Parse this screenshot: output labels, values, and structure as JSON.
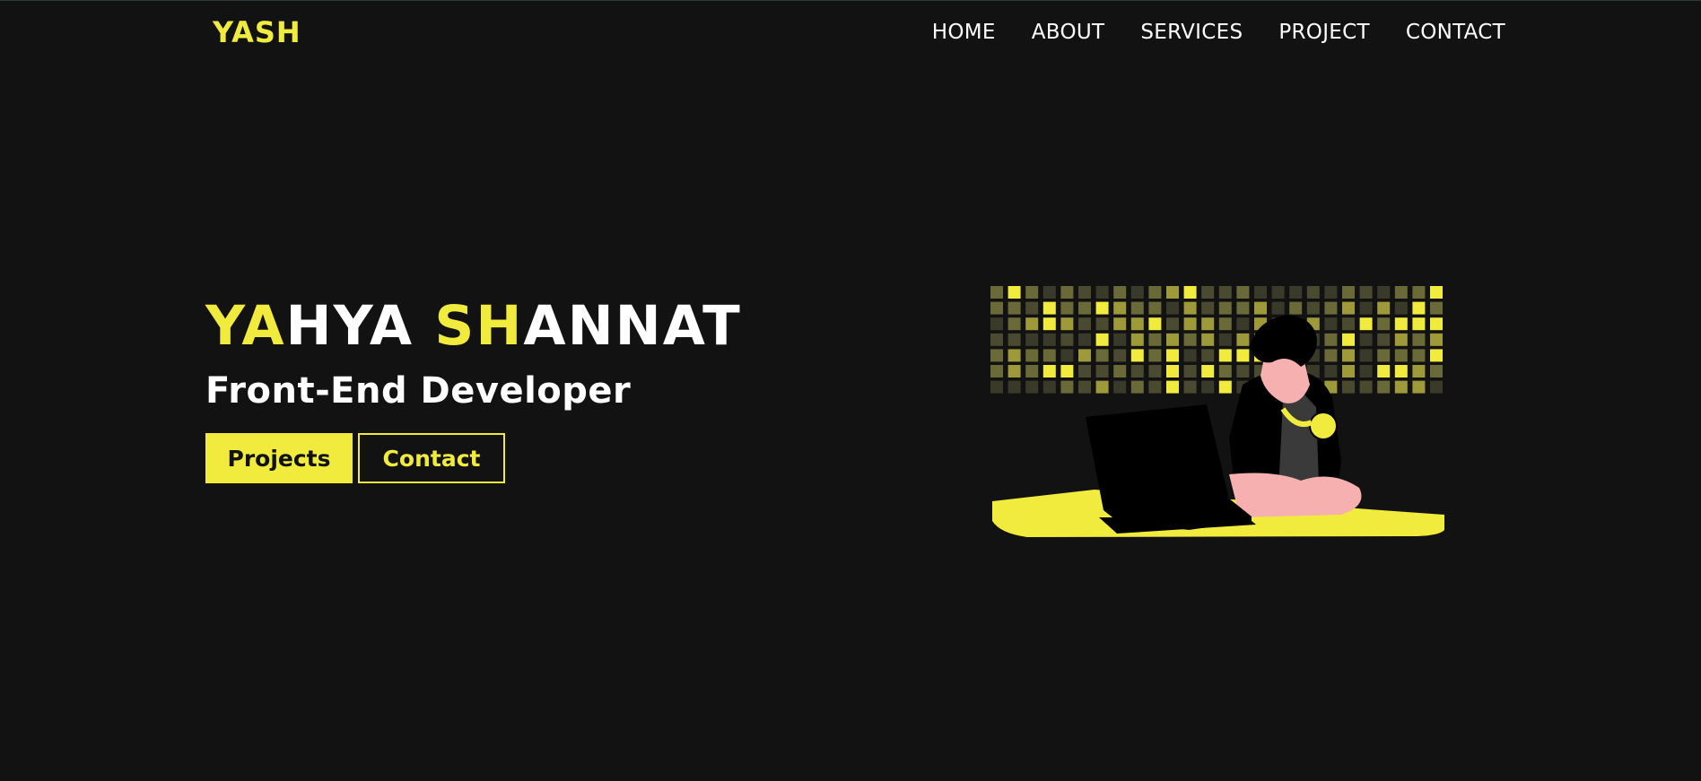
{
  "header": {
    "logo": "YASH",
    "nav": [
      {
        "label": "HOME"
      },
      {
        "label": "ABOUT"
      },
      {
        "label": "SERVICES"
      },
      {
        "label": "PROJECT"
      },
      {
        "label": "CONTACT"
      }
    ]
  },
  "hero": {
    "name_parts": [
      "YA",
      "HYA ",
      "SH",
      "ANNAT"
    ],
    "subtitle": "Front-End Developer",
    "primary_button": "Projects",
    "secondary_button": "Contact"
  },
  "colors": {
    "accent": "#f0eb3c",
    "background": "#121212",
    "text": "#ffffff"
  }
}
